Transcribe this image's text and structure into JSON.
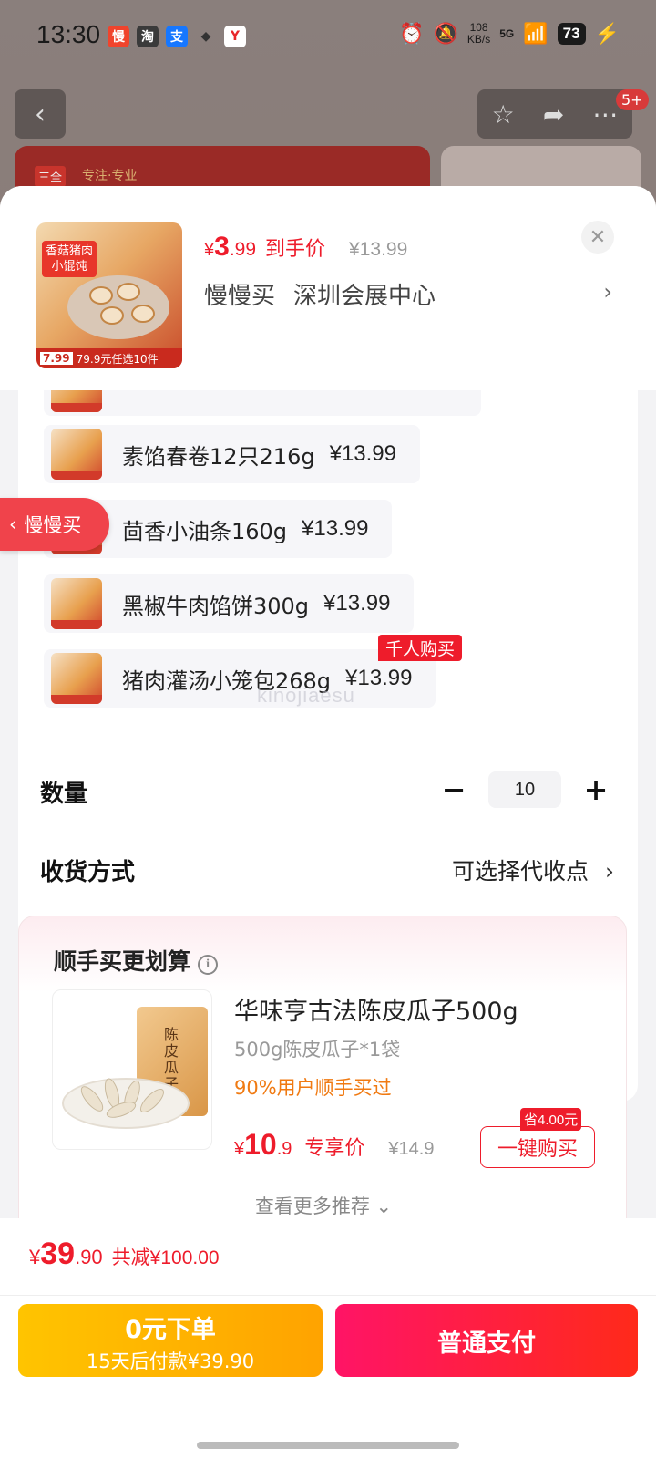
{
  "status_bar": {
    "time": "13:30",
    "apps": [
      {
        "icon": "manmanmai-app-icon",
        "glyph": "慢",
        "color": "#f0442c"
      },
      {
        "icon": "taobao-app-icon",
        "glyph": "淘",
        "color": "#3a3a3a"
      },
      {
        "icon": "alipay-app-icon",
        "glyph": "支",
        "color": "#1677ff"
      },
      {
        "icon": "bird-app-icon",
        "glyph": "◆",
        "color": "#333333"
      },
      {
        "icon": "y-app-icon",
        "glyph": "Y",
        "color": "#ffffff"
      }
    ],
    "net_speed_value": "108",
    "net_speed_unit": "KB/s",
    "signal": "5G",
    "battery": "73"
  },
  "background_page": {
    "banner_logo": "三全",
    "banner_text": "专注·专业",
    "notification_badge": "5+"
  },
  "header": {
    "currency": "¥",
    "price_int": "3",
    "price_dec": ".99",
    "price_tag": "到手价",
    "original_price": "¥13.99",
    "store_brand": "慢慢买",
    "store_location": "深圳会展中心",
    "thumb_title": "香菇猪肉小馄饨",
    "thumb_promo_price": "7.99",
    "thumb_promo_text": "79.9元任选10件"
  },
  "options": [
    {
      "label": "素馅春卷12只216g",
      "price": "¥13.99"
    },
    {
      "label": "茴香小油条160g",
      "price": "¥13.99"
    },
    {
      "label": "黑椒牛肉馅饼300g",
      "price": "¥13.99"
    },
    {
      "label": "猪肉灌汤小笼包268g",
      "price": "¥13.99",
      "tag": "千人购买"
    }
  ],
  "watermark": "kinojiaesu",
  "quantity": {
    "label": "数量",
    "value": "10",
    "minus": "−",
    "plus": "+"
  },
  "delivery": {
    "label": "收货方式",
    "value": "可选择代收点"
  },
  "upsell": {
    "title": "顺手买更划算",
    "product_name": "华味亨古法陈皮瓜子500g",
    "spec": "500g陈皮瓜子*1袋",
    "stat": "90%用户顺手买过",
    "currency": "¥",
    "price_int": "10",
    "price_dec": ".9",
    "price_tag": "专享价",
    "original_price": "¥14.9",
    "save_tag": "省4.00元",
    "buy_label": "一键购买",
    "more_label": "查看更多推荐",
    "bag_text": "陈皮瓜子"
  },
  "bottom": {
    "currency": "¥",
    "total_int": "39",
    "total_dec": ".90",
    "discount": "共减¥100.00",
    "zero_pay_line1": "0元下单",
    "zero_pay_line2": "15天后付款¥39.90",
    "pay_label": "普通支付"
  },
  "back_pill": {
    "label": "慢慢买"
  },
  "colors": {
    "accent_red": "#ee1c2b",
    "accent_orange": "#ffa300",
    "pay_gradient_start": "#ff1466"
  }
}
